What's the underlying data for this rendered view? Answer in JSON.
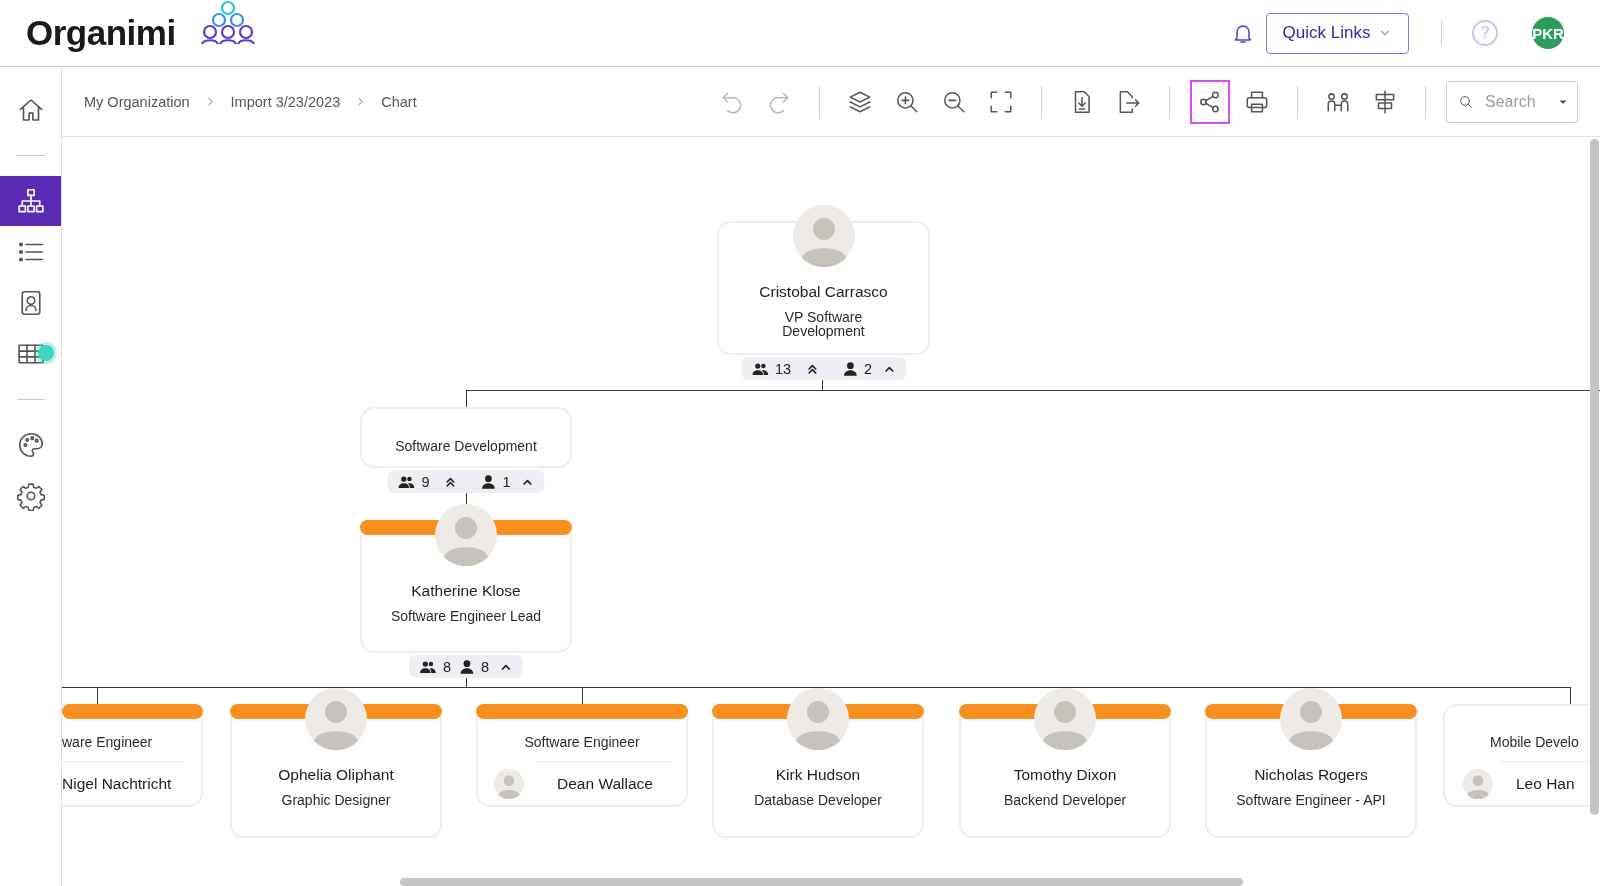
{
  "header": {
    "logo": "Organimi",
    "quick_links": "Quick Links",
    "help": "?",
    "user_initials": "PKR"
  },
  "sidebar": {
    "groups": [
      [
        {
          "kind": "home",
          "selected": false,
          "dot": false
        }
      ],
      [
        {
          "kind": "chart",
          "selected": true,
          "dot": false
        },
        {
          "kind": "list",
          "selected": false,
          "dot": false
        },
        {
          "kind": "contact",
          "selected": false,
          "dot": false
        },
        {
          "kind": "grid",
          "selected": false,
          "dot": true
        }
      ],
      [
        {
          "kind": "palette",
          "selected": false,
          "dot": false
        },
        {
          "kind": "settings",
          "selected": false,
          "dot": false
        }
      ]
    ]
  },
  "breadcrumbs": [
    {
      "label": "My Organization"
    },
    {
      "label": "Import 3/23/2023"
    },
    {
      "label": "Chart"
    }
  ],
  "toolbar": {
    "groups": [
      [
        {
          "kind": "undo",
          "disabled": true,
          "selected": false
        },
        {
          "kind": "redo",
          "disabled": true,
          "selected": false
        }
      ],
      [
        {
          "kind": "layers",
          "disabled": false,
          "selected": false
        },
        {
          "kind": "zoom_in",
          "disabled": false,
          "selected": false
        },
        {
          "kind": "zoom_out",
          "disabled": false,
          "selected": false
        },
        {
          "kind": "fit",
          "disabled": false,
          "selected": false
        }
      ],
      [
        {
          "kind": "import",
          "disabled": false,
          "selected": false
        },
        {
          "kind": "export",
          "disabled": false,
          "selected": false
        }
      ],
      [
        {
          "kind": "share",
          "disabled": false,
          "selected": true
        },
        {
          "kind": "print",
          "disabled": false,
          "selected": false
        }
      ],
      [
        {
          "kind": "people",
          "disabled": false,
          "selected": false
        },
        {
          "kind": "align",
          "disabled": false,
          "selected": false
        }
      ]
    ],
    "search": {
      "placeholder": "Search"
    }
  },
  "chart": {
    "root": {
      "kind": "person",
      "name": "Cristobal Carrasco",
      "title": "VP Software Development",
      "accent": false,
      "stats": {
        "team": "13",
        "direct": "2",
        "collapse_all": true
      },
      "children": [
        {
          "kind": "department",
          "title": "Software Development",
          "stats": {
            "team": "9",
            "direct": "1",
            "collapse_all": true
          },
          "children": [
            {
              "kind": "person",
              "name": "Katherine Klose",
              "title": "Software Engineer Lead",
              "accent": true,
              "stats": {
                "team": "8",
                "direct": "8",
                "collapse_all": false
              },
              "children": [
                {
                  "kind": "role",
                  "title": "ware Engineer",
                  "name": "Nigel Nachtricht",
                  "accent": true
                },
                {
                  "kind": "person",
                  "name": "Ophelia Oliphant",
                  "title": "Graphic Designer",
                  "accent": true
                },
                {
                  "kind": "role",
                  "title": "Software Engineer",
                  "name": "Dean Wallace",
                  "accent": true
                },
                {
                  "kind": "person",
                  "name": "Kirk Hudson",
                  "title": "Database Developer",
                  "accent": true
                },
                {
                  "kind": "person",
                  "name": "Tomothy Dixon",
                  "title": "Backend Developer",
                  "accent": true
                },
                {
                  "kind": "person",
                  "name": "Nicholas Rogers",
                  "title": "Software Engineer - API",
                  "accent": true
                },
                {
                  "kind": "role",
                  "title": "Mobile Develo",
                  "name": "Leo Han",
                  "accent": false
                }
              ]
            }
          ]
        }
      ]
    }
  }
}
